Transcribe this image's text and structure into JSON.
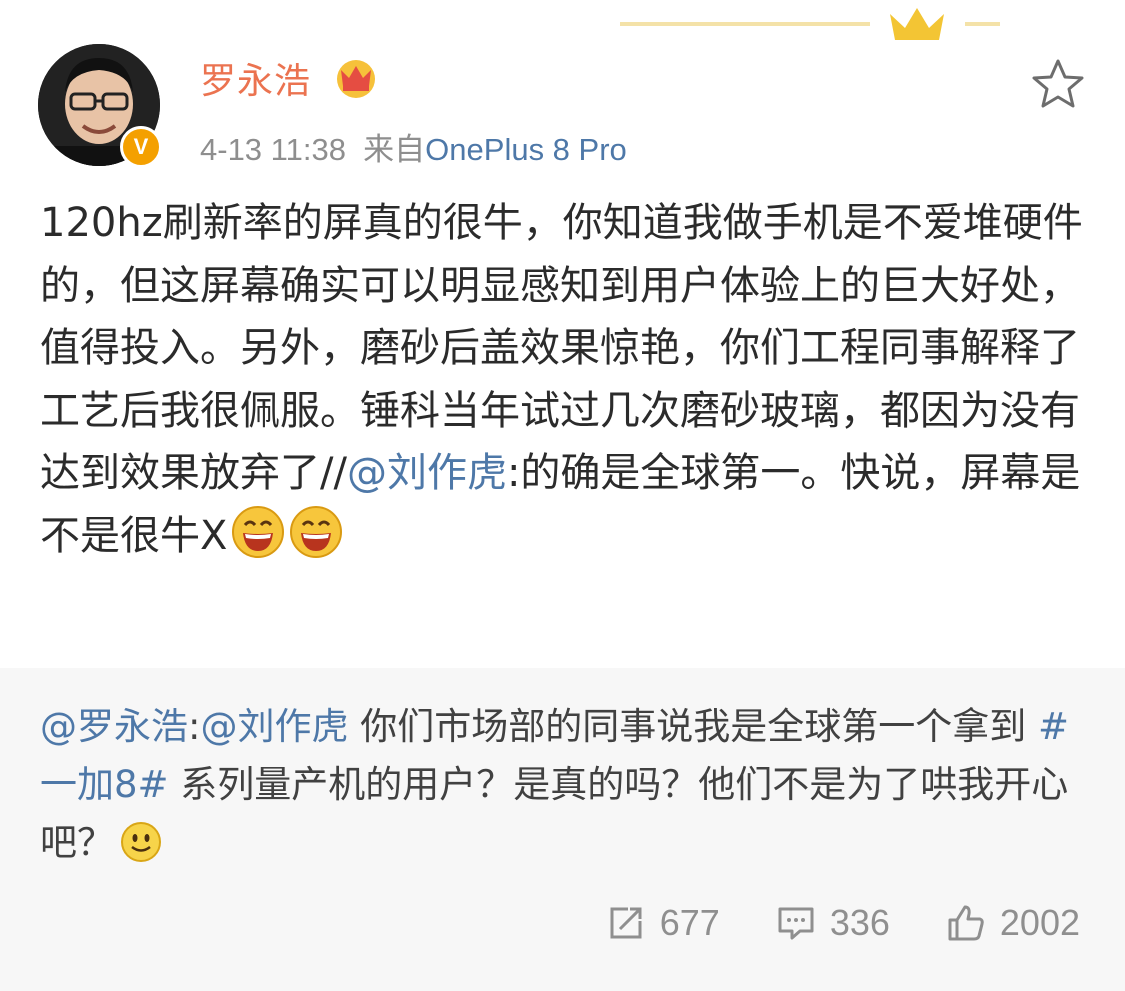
{
  "author": {
    "name": "罗永浩",
    "verified_badge": "V"
  },
  "meta": {
    "time": "4-13 11:38",
    "from_prefix": "来自",
    "source": "OnePlus 8 Pro"
  },
  "post": {
    "text_before": "120hz刷新率的屏真的很牛，你知道我做手机是不爱堆硬件的，但这屏幕确实可以明显感知到用户体验上的巨大好处，值得投入。另外，磨砂后盖效果惊艳，你们工程同事解释了工艺后我很佩服。锤科当年试过几次磨砂玻璃，都因为没有达到效果放弃了//",
    "mention": "@刘作虎",
    "text_after": ":的确是全球第一。快说，屏幕是不是很牛X"
  },
  "repost": {
    "mention1": "@罗永浩",
    "colon": ":",
    "mention2": "@刘作虎",
    "text1": " 你们市场部的同事说我是全球第一个拿到 ",
    "hashtag": "#一加8#",
    "text2": " 系列量产机的用户？是真的吗？他们不是为了哄我开心吧？"
  },
  "actions": {
    "repost_count": "677",
    "comment_count": "336",
    "like_count": "2002"
  },
  "colors": {
    "name": "#eb7350",
    "link": "#4e78a8",
    "meta": "#8e8e8e",
    "quote_bg": "#f7f7f7"
  },
  "icons": [
    "crown-decoration-icon",
    "avatar",
    "verified-icon",
    "vip-crown-icon",
    "star-icon",
    "laugh-emoji-icon",
    "smile-emoji-icon",
    "repost-icon",
    "comment-icon",
    "like-icon"
  ]
}
